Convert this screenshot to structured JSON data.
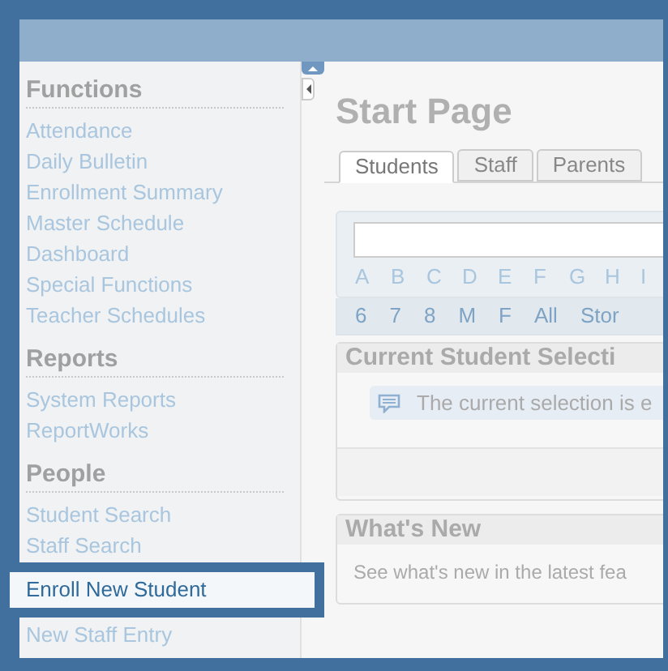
{
  "sidebar": {
    "sections": [
      {
        "title": "Functions",
        "items": [
          "Attendance",
          "Daily Bulletin",
          "Enrollment Summary",
          "Master Schedule",
          "Dashboard",
          "Special Functions",
          "Teacher Schedules"
        ]
      },
      {
        "title": "Reports",
        "items": [
          "System Reports",
          "ReportWorks"
        ]
      },
      {
        "title": "People",
        "items": [
          "Student Search",
          "Staff Search"
        ]
      }
    ]
  },
  "highlighted_item": "Enroll New Student",
  "below_highlight": [
    "New Staff Entry"
  ],
  "page_title": "Start Page",
  "tabs": [
    {
      "label": "Students",
      "selected": true
    },
    {
      "label": "Staff",
      "selected": false
    },
    {
      "label": "Parents",
      "selected": false
    }
  ],
  "letters": [
    "A",
    "B",
    "C",
    "D",
    "E",
    "F",
    "G",
    "H",
    "I"
  ],
  "filters": [
    "6",
    "7",
    "8",
    "M",
    "F",
    "All",
    "Stor"
  ],
  "current_selection": {
    "title": "Current Student Selecti",
    "message": "The current selection is e"
  },
  "whats_new": {
    "title": "What's New",
    "text": "See what's new in the latest fea"
  }
}
